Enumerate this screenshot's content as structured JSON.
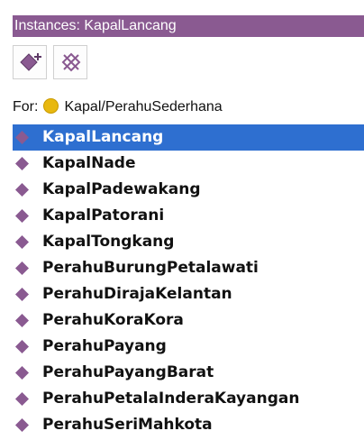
{
  "panel": {
    "title": "Instances: KapalLancang"
  },
  "toolbar": {
    "buttons": [
      {
        "name": "add-instance",
        "icon": "add-individual-icon"
      },
      {
        "name": "delete-instance",
        "icon": "delete-individual-icon"
      }
    ]
  },
  "for_row": {
    "label": "For:",
    "class_name": "Kapal/PerahuSederhana",
    "class_icon": "class-circle-icon"
  },
  "instances": {
    "items": [
      {
        "label": "KapalLancang",
        "selected": true
      },
      {
        "label": "KapalNade",
        "selected": false
      },
      {
        "label": "KapalPadewakang",
        "selected": false
      },
      {
        "label": "KapalPatorani",
        "selected": false
      },
      {
        "label": "KapalTongkang",
        "selected": false
      },
      {
        "label": "PerahuBurungPetalawati",
        "selected": false
      },
      {
        "label": "PerahuDirajaKelantan",
        "selected": false
      },
      {
        "label": "PerahuKoraKora",
        "selected": false
      },
      {
        "label": "PerahuPayang",
        "selected": false
      },
      {
        "label": "PerahuPayangBarat",
        "selected": false
      },
      {
        "label": "PerahuPetalaInderaKayangan",
        "selected": false
      },
      {
        "label": "PerahuSeriMahkota",
        "selected": false
      }
    ]
  },
  "colors": {
    "title_bar": "#8a5a91",
    "selection": "#2e6fd0",
    "instance_diamond": "#8a5a91",
    "class_dot": "#e8b810"
  }
}
